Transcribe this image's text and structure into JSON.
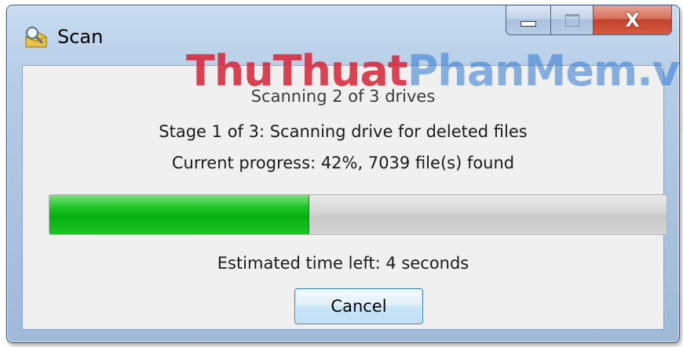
{
  "window": {
    "title": "Scan",
    "icon": "scan-magnifier-icon",
    "caption_buttons": {
      "minimize_icon": "minimize-icon",
      "maximize_icon": "maximize-icon",
      "close_icon": "close-icon",
      "close_glyph": "X"
    }
  },
  "watermark": {
    "part1": "ThuThuat",
    "part2": "PhanMem.vn",
    "color1": "#d6283c",
    "color2": "#2d78d2"
  },
  "status": {
    "drives_line": "Scanning 2 of 3 drives",
    "stage_line": "Stage 1 of 3: Scanning drive for deleted files",
    "progress_line": "Current progress: 42%, 7039 file(s) found",
    "eta_line": "Estimated time left: 4 seconds"
  },
  "progress": {
    "percent": 42,
    "fill_color": "#06b010"
  },
  "actions": {
    "cancel_label": "Cancel"
  }
}
